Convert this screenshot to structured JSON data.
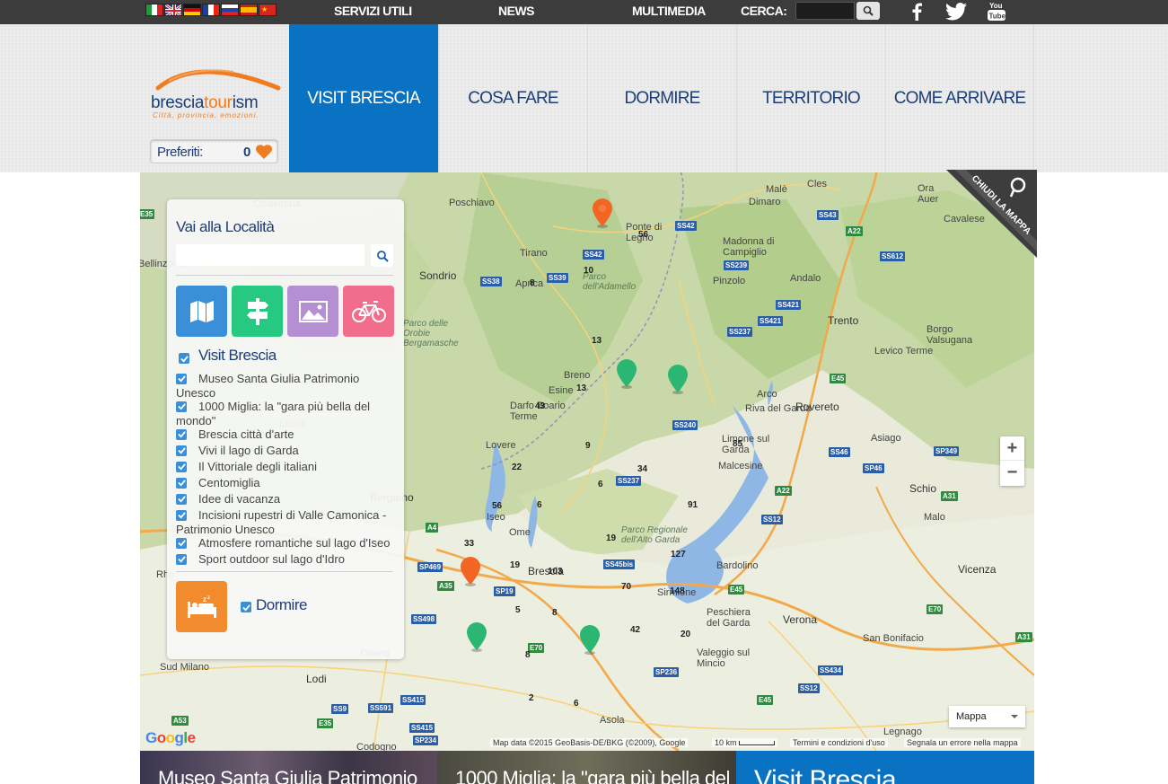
{
  "topbar": {
    "flags": [
      "it",
      "en",
      "de",
      "fr",
      "ru",
      "es",
      "cn"
    ],
    "links": {
      "servizi": "SERVIZI UTILI",
      "news": "NEWS",
      "multimedia": "MULTIMEDIA",
      "cerca": "CERCA:"
    },
    "social": [
      "facebook-icon",
      "twitter-icon",
      "youtube-icon"
    ],
    "youtube_text": "You\nTube"
  },
  "header": {
    "logo_text": "bresciatourism",
    "logo_tagline": "Città, provincia, emozioni.",
    "preferiti_label": "Preferiti:",
    "preferiti_count": "0",
    "nav": [
      "VISIT BRESCIA",
      "COSA FARE",
      "DORMIRE",
      "TERRITORIO",
      "COME ARRIVARE"
    ],
    "active_nav": "VISIT BRESCIA",
    "accent": "#0a72c2",
    "brand_orange": "#f07c22"
  },
  "map": {
    "close_label": "CHIUDI LA MAPPA",
    "zoom_in": "+",
    "zoom_out": "−",
    "map_type": "Mappa",
    "attribution": "Map data ©2015 GeoBasis-DE/BKG (©2009), Google",
    "scale": "10 km",
    "terms": "Termini e condizioni d'uso",
    "report": "Segnala un errore nella mappa",
    "google": "Google",
    "places": [
      "Poschiavo",
      "Tirano",
      "Sondrio",
      "Aprica",
      "Ponte di Legno",
      "Malè",
      "Cles",
      "Dimaro",
      "Madonna di Campiglio",
      "Pinzolo",
      "Andalo",
      "Trento",
      "Borgo Valsugana",
      "Levico Terme",
      "Breno",
      "Esine",
      "Darfo Boario Terme",
      "Lovere",
      "Iseo",
      "Ome",
      "Brescia",
      "Riva del Garda",
      "Arco",
      "Rovereto",
      "Limone sul Garda",
      "Malcesine",
      "Asiago",
      "Schio",
      "Malo",
      "Vicenza",
      "Bardolino",
      "Sirmione",
      "Peschiera del Garda",
      "Verona",
      "San Bonifacio",
      "Valeggio sul Mincio",
      "Asola",
      "Legnago",
      "Lodi",
      "Codogno",
      "Bergamo",
      "Lecco",
      "Chiavenna",
      "Bellinzona",
      "Ora",
      "Auer",
      "Cavalese",
      "Rho",
      "Sud Milano",
      "Crema"
    ],
    "water_labels": [
      "Parco delle Orobie Bergamasche",
      "Parco dell'Adamello",
      "Parco Regionale dell'Alto Garda"
    ],
    "road_labels": [
      "E35",
      "SS38",
      "SS39",
      "SS42",
      "SS43",
      "SS239",
      "SS421",
      "SS237",
      "SS240",
      "SS12",
      "SS46",
      "SP46",
      "SP349",
      "A22",
      "E45",
      "A4",
      "SP469",
      "A35",
      "SP19",
      "SS45bis",
      "SS498",
      "E70",
      "SP236",
      "SS434",
      "SS415",
      "SS591",
      "SP234",
      "A31",
      "E70",
      "SS612",
      "SS9",
      "A53",
      "E35"
    ],
    "cluster_numbers": [
      "56",
      "10",
      "8",
      "13",
      "13",
      "43",
      "9",
      "22",
      "34",
      "6",
      "85",
      "91",
      "6",
      "56",
      "33",
      "19",
      "19",
      "103",
      "127",
      "70",
      "148",
      "5",
      "8",
      "42",
      "20",
      "8",
      "2",
      "6"
    ],
    "pins": [
      {
        "color": "orange",
        "label": "Ponte di Legno pin"
      },
      {
        "color": "green",
        "label": "Breno pin 1"
      },
      {
        "color": "green",
        "label": "Breno pin 2"
      },
      {
        "color": "orange",
        "label": "Brescia west pin"
      },
      {
        "color": "green",
        "label": "south pin 1"
      },
      {
        "color": "green",
        "label": "south pin 2"
      }
    ]
  },
  "panel": {
    "title": "Vai alla Località",
    "search_placeholder": "",
    "categories": [
      {
        "name": "map",
        "color": "#3a8fd8"
      },
      {
        "name": "signpost",
        "color": "#26c97f"
      },
      {
        "name": "landscape",
        "color": "#b48fd1"
      },
      {
        "name": "bicycle",
        "color": "#f06e8c"
      }
    ],
    "section": "Visit Brescia",
    "items": [
      "Museo Santa Giulia Patrimonio Unesco",
      "1000 Miglia: la \"gara più bella del mondo\"",
      "Brescia città d'arte",
      "Vivi il lago di Garda",
      "Il Vittoriale degli italiani",
      "Centomiglia",
      "Idee di vacanza",
      "Incisioni rupestri di Valle Camonica - Patrimonio Unesco",
      "Atmosfere romantiche sul lago d'Iseo",
      "Sport outdoor sul lago d'Idro"
    ],
    "dormire": "Dormire",
    "dormire_color": "#f28a2e"
  },
  "strip": {
    "card1": "Museo Santa Giulia Patrimonio",
    "card2": "1000 Miglia: la \"gara più bella del",
    "card3": "Visit Brescia"
  }
}
